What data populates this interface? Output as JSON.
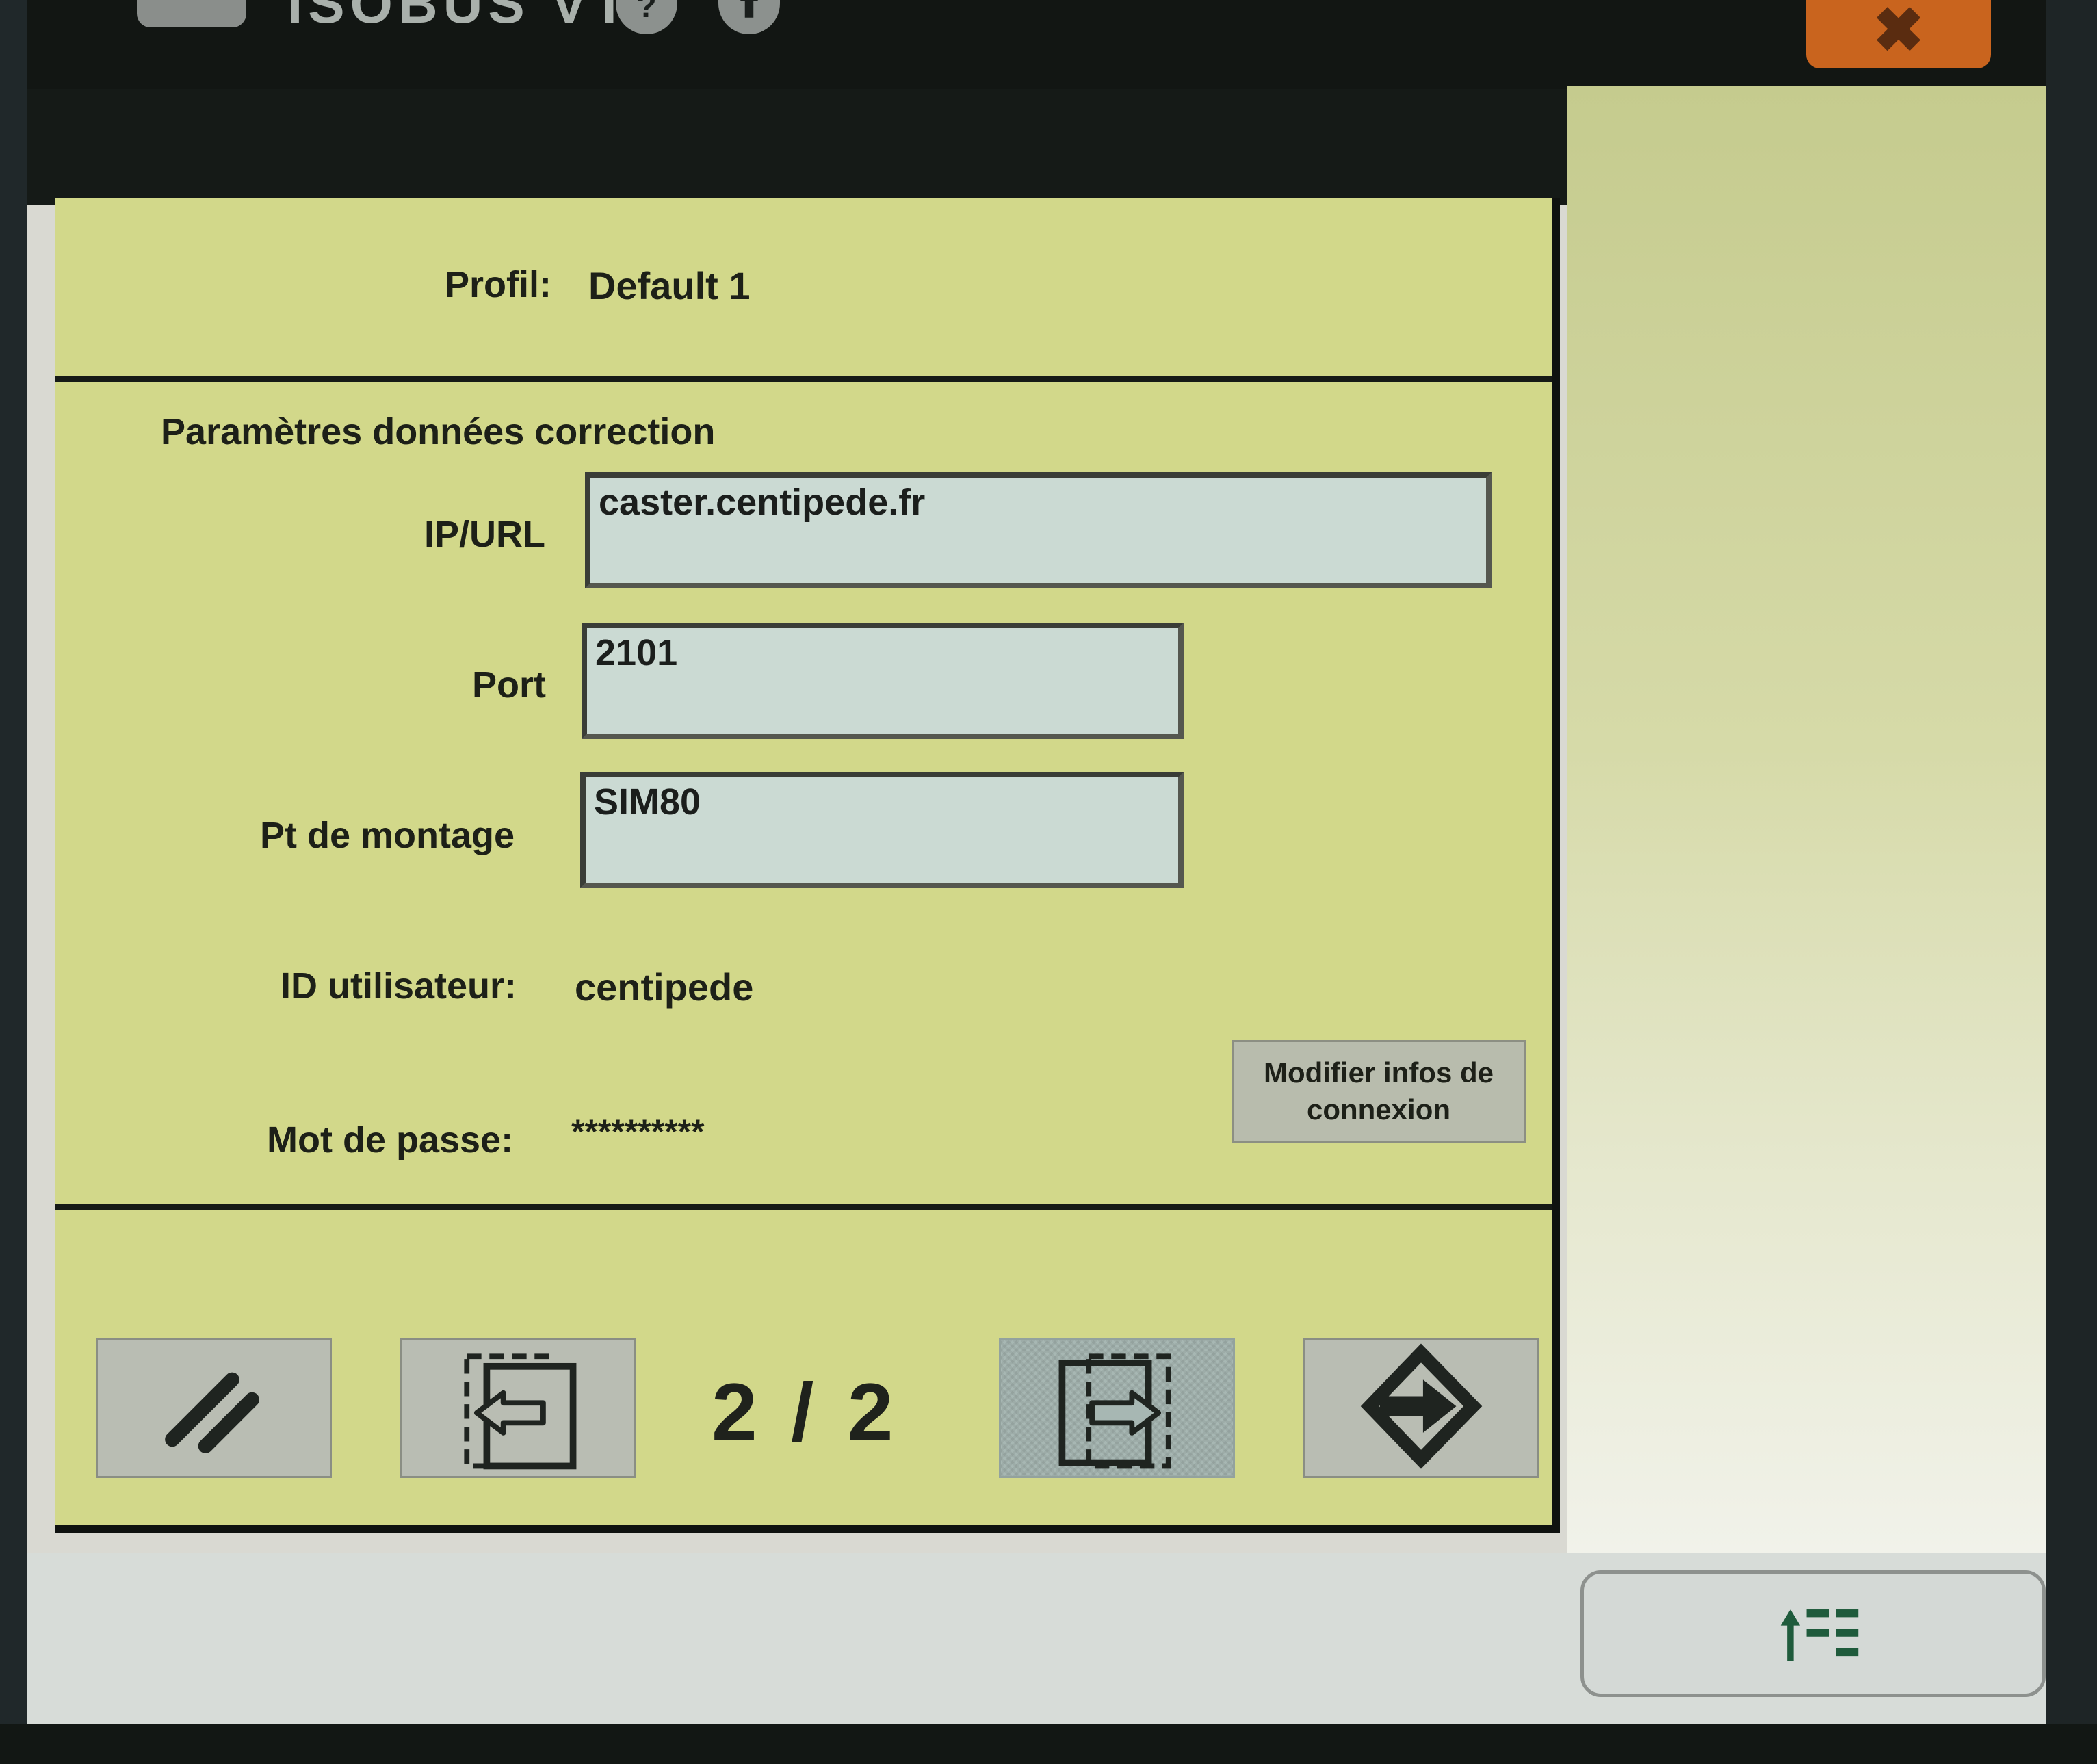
{
  "app": {
    "title": "ISOBUS VT",
    "close_symbol": "✖"
  },
  "icons": {
    "help": "help-icon",
    "upload": "upload-icon"
  },
  "profile": {
    "label": "Profil:",
    "value": "Default 1"
  },
  "section": {
    "title": "Paramètres données correction"
  },
  "fields": {
    "ip_label": "IP/URL",
    "ip_value": "caster.centipede.fr",
    "port_label": "Port",
    "port_value": "2101",
    "mount_label": "Pt de montage",
    "mount_value": "SIM80"
  },
  "credentials": {
    "user_label": "ID utilisateur:",
    "user_value": "centipede",
    "password_label": "Mot de passe:",
    "password_value": "**********"
  },
  "buttons": {
    "modify_label": "Modifier infos de connexion"
  },
  "pagination": {
    "current": "2 / 2"
  },
  "colors": {
    "panel": "#d2d88a",
    "field": "#cbdad3",
    "close": "#c9641e",
    "list_icon": "#1f5b3c"
  }
}
